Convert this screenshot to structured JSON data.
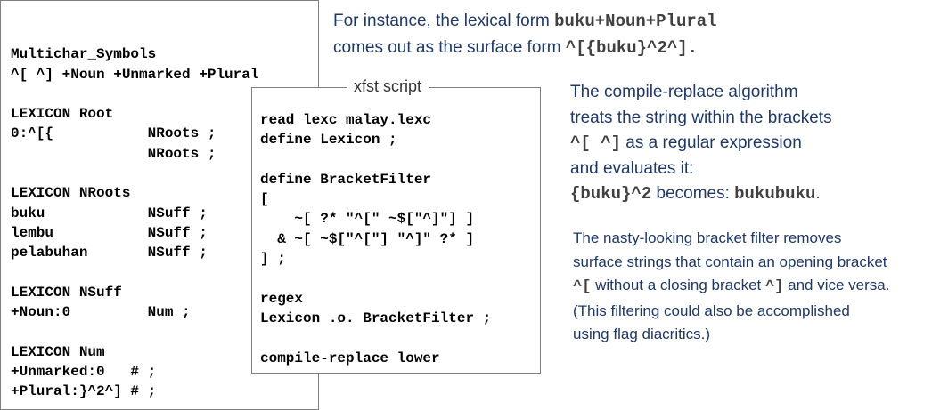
{
  "lexc": {
    "lines": [
      "",
      "Multichar_Symbols",
      "^[ ^] +Noun +Unmarked +Plural",
      "",
      "LEXICON Root",
      "0:^[{           NRoots ;",
      "                NRoots ;",
      "",
      "LEXICON NRoots",
      "buku            NSuff ;",
      "lembu           NSuff ;",
      "pelabuhan       NSuff ;",
      "",
      "LEXICON NSuff",
      "+Noun:0         Num ;",
      "",
      "LEXICON Num",
      "+Unmarked:0   # ;",
      "+Plural:}^2^] # ;"
    ]
  },
  "xfst": {
    "title": "xfst script",
    "lines": [
      "read lexc malay.lexc",
      "define Lexicon ;",
      "",
      "define BracketFilter",
      "[",
      "    ~[ ?* \"^[\" ~$[\"^]\"] ]",
      "  & ~[ ~$[\"^[\"] \"^]\" ?* ]",
      "] ;",
      "",
      "regex",
      "Lexicon .o. BracketFilter ;",
      "",
      "compile-replace lower"
    ]
  },
  "note1": {
    "line1_text": "For instance, the lexical form ",
    "line1_code": "buku+Noun+Plural",
    "line2_text": "comes out as the surface form ",
    "line2_code": "^[{buku}^2^]."
  },
  "note2": {
    "line1": "The compile-replace algorithm",
    "line2": " treats the string within the brackets",
    "line3_code": " ^[  ^]",
    "line3_text": " as a regular expression",
    "line4": " and evaluates it:",
    "line5_code": " {buku}^2",
    "line5_text": " becomes: ",
    "line5_code2": "bukubuku",
    "line5_end": "."
  },
  "note3": {
    "line1": "The nasty-looking bracket filter removes",
    "line2": "surface strings that contain an opening bracket",
    "line3_code": "^[",
    "line3_text_a": " without a closing bracket ",
    "line3_code2": "^]",
    "line3_text_b": " and vice versa.",
    "line4": "(This filtering could also be accomplished",
    "line5": " using flag diacritics.)"
  }
}
